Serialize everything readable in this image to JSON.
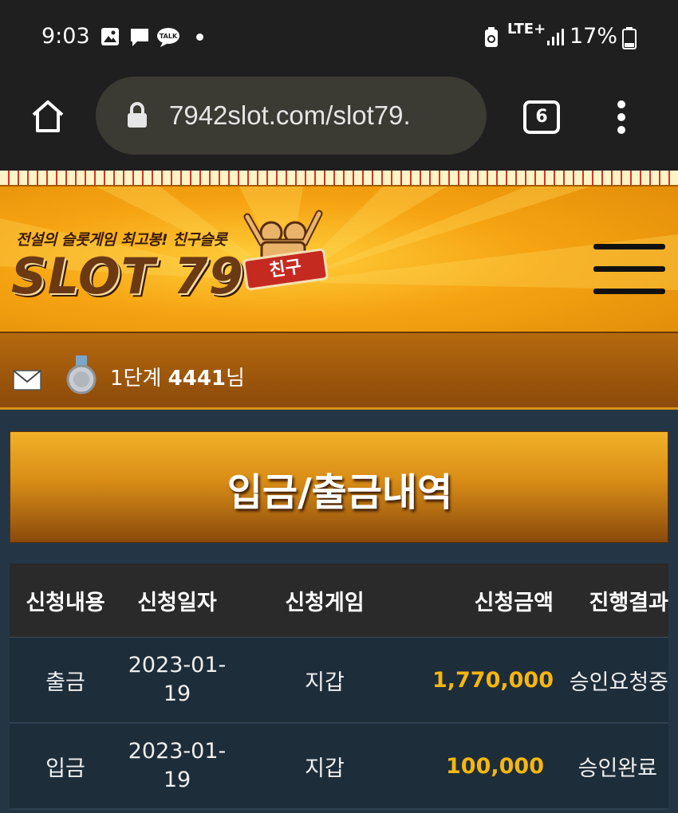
{
  "status_bar": {
    "time": "9:03",
    "battery": "17%",
    "network": "LTE+",
    "icons": [
      "gallery-icon",
      "message-icon",
      "kakaotalk-icon",
      "notification-dot",
      "battery-saver-icon",
      "signal-icon",
      "battery-icon"
    ]
  },
  "browser": {
    "url": "7942slot.com/slot79.",
    "tab_count": "6",
    "icons": [
      "home-icon",
      "lock-icon",
      "tabs-icon",
      "more-vert-icon"
    ]
  },
  "site": {
    "tagline": "전설의 슬롯게임 최고봉! 친구슬롯",
    "logo_text": "SLOT 79",
    "logo_badge": "친구"
  },
  "user": {
    "level": "1단계",
    "name": "4441",
    "suffix": "님"
  },
  "page": {
    "title": "입금/출금내역"
  },
  "table": {
    "headers": [
      "신청내용",
      "신청일자",
      "신청게임",
      "신청금액",
      "진행결과"
    ],
    "rows": [
      {
        "type": "출금",
        "date_line1": "2023-01-",
        "date_line2": "19",
        "game": "지갑",
        "amount": "1,770,000",
        "result": "승인요청중"
      },
      {
        "type": "입금",
        "date_line1": "2023-01-",
        "date_line2": "19",
        "game": "지갑",
        "amount": "100,000",
        "result": "승인완료"
      }
    ]
  },
  "colors": {
    "amount": "#f5b60f",
    "header_gold": "#f6a412",
    "content_bg": "#243645"
  }
}
